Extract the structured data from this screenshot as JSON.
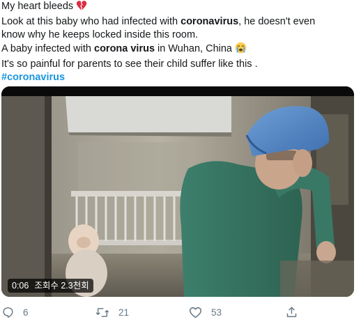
{
  "tweet": {
    "line1_text": "My heart bleeds",
    "line2_pre": "Look at this baby who had infected with ",
    "line2_bold": "coronavirus",
    "line2_post": ", he doesn't even",
    "line3": "know why he keeps locked inside this room.",
    "line4_pre": "A baby infected with ",
    "line4_bold": "corona virus",
    "line4_post": " in Wuhan, China",
    "line5": "It's so painful for parents to see their child suffer like this .",
    "hashtag": "#coronavirus",
    "emoji_1": "broken-heart-icon",
    "emoji_2": "crying-face-icon"
  },
  "video": {
    "duration": "0:06",
    "views": "조회수 2.3천회"
  },
  "actions": {
    "reply_count": "6",
    "retweet_count": "21",
    "like_count": "53"
  },
  "colors": {
    "text": "#14171a",
    "link": "#1b95e0",
    "muted": "#657786",
    "broken_heart": "#dd2e44"
  }
}
